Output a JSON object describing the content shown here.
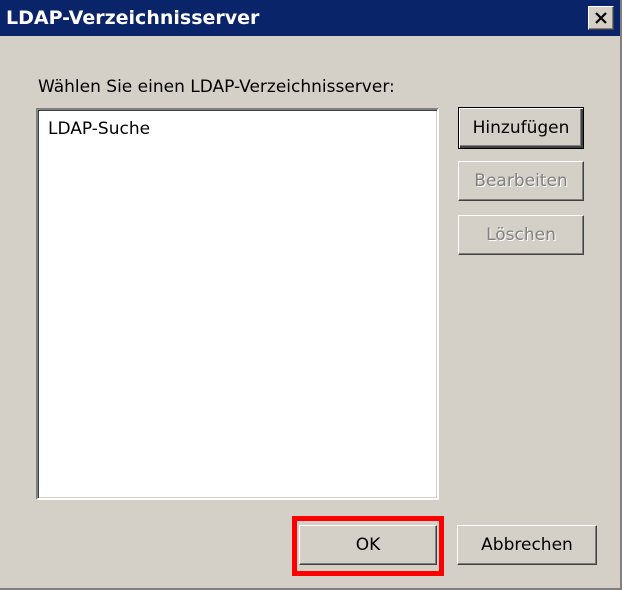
{
  "window": {
    "title": "LDAP-Verzeichnisserver"
  },
  "dialog": {
    "prompt_label": "Wählen Sie einen LDAP-Verzeichnisserver:",
    "server_list": [
      "LDAP-Suche"
    ]
  },
  "buttons": {
    "add_label": "Hinzufügen",
    "edit_label": "Bearbeiten",
    "edit_enabled": false,
    "delete_label": "Löschen",
    "delete_enabled": false,
    "ok_label": "OK",
    "cancel_label": "Abbrechen"
  },
  "icons": {
    "close": "close-icon"
  },
  "colors": {
    "titlebar": "#0a246a",
    "dialog_background": "#d4d0c8",
    "highlight": "#ff0000"
  }
}
